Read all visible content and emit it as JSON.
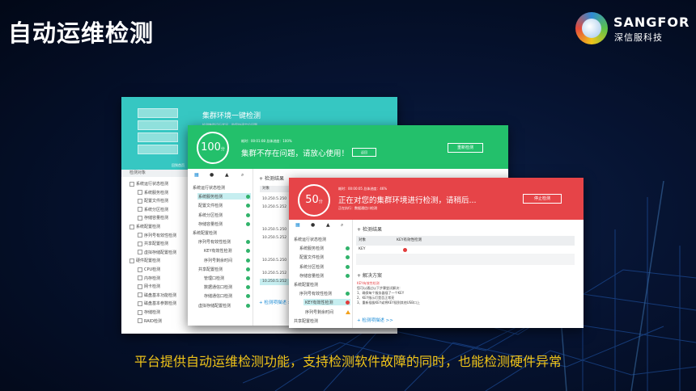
{
  "slide": {
    "title": "自动运维检测",
    "caption": "平台提供自动运维检测功能，支持检测软件故障的同时，也能检测硬件异常"
  },
  "logo": {
    "brand": "SANGFOR",
    "cn": "深信服科技"
  },
  "colors": {
    "teal": "#36c7c2",
    "green": "#23c06b",
    "red": "#e64448",
    "caption": "#f0c419"
  },
  "window1": {
    "title": "集群环境一键检测",
    "subtitle": "检测集群运行状况，助您快速定位问题",
    "back_link": "回到首页",
    "table_header": "检测对象",
    "tree": [
      {
        "label": "系统运行状态检测",
        "level": 0
      },
      {
        "label": "系统服务检测",
        "level": 1
      },
      {
        "label": "配置文件检测",
        "level": 1
      },
      {
        "label": "系统分区检测",
        "level": 1
      },
      {
        "label": "存储容量检测",
        "level": 1
      },
      {
        "label": "系统配置检测",
        "level": 0
      },
      {
        "label": "序列号有效性检测",
        "level": 1
      },
      {
        "label": "共享配置检测",
        "level": 1
      },
      {
        "label": "虚拟存储配置检测",
        "level": 1
      },
      {
        "label": "硬件配置检测",
        "level": 0
      },
      {
        "label": "CPU检测",
        "level": 1
      },
      {
        "label": "内存检测",
        "level": 1
      },
      {
        "label": "网卡检测",
        "level": 1
      },
      {
        "label": "磁盘基本功能检测",
        "level": 1
      },
      {
        "label": "磁盘基本参数检测",
        "level": 1
      },
      {
        "label": "存储检测",
        "level": 1
      },
      {
        "label": "RAID检测",
        "level": 1
      }
    ]
  },
  "window2": {
    "score": "100",
    "score_unit": "分",
    "meta": "耗时：00:01:08    总体进度：100%",
    "message": "集群不存在问题，请放心使用！",
    "small_button": "返回",
    "recheck_button": "重新检测",
    "result_title": "检测结果",
    "object_header": "对象",
    "tree": [
      {
        "label": "系统运行状态检测",
        "level": 0
      },
      {
        "label": "系统服务检测",
        "level": 1
      },
      {
        "label": "配置文件检测",
        "level": 1
      },
      {
        "label": "系统分区检测",
        "level": 1
      },
      {
        "label": "存储容量检测",
        "level": 1
      },
      {
        "label": "系统配置检测",
        "level": 0
      },
      {
        "label": "序列号有效性检测",
        "level": 1
      },
      {
        "label": "KEY有效性检测",
        "level": 2
      },
      {
        "label": "序列号剩余时间",
        "level": 2
      },
      {
        "label": "共享配置检测",
        "level": 1
      },
      {
        "label": "管理口检测",
        "level": 2
      },
      {
        "label": "数据通信口检测",
        "level": 2
      },
      {
        "label": "存储通信口检测",
        "level": 2
      },
      {
        "label": "虚拟存储配置检测",
        "level": 1
      }
    ],
    "objects": [
      "10.250.5.250",
      "10.250.5.252",
      "10.250.5.250",
      "10.250.5.252",
      "10.250.5.250",
      "10.250.5.252",
      "10.250.5.252"
    ],
    "more_link": "+ 检测项描述 >>"
  },
  "window3": {
    "score": "50",
    "score_unit": "分",
    "meta": "耗时：00:00:05    总体进度：46%",
    "message": "正在对您的集群环境进行检测，请稍后...",
    "subtext": "正在执行：数据通信口检测",
    "stop_button": "停止检测",
    "result_title": "检测结果",
    "table": {
      "col1": "对象",
      "col2": "KEY有效性检测",
      "row_obj": "KEY"
    },
    "tree": [
      {
        "label": "系统运行状态检测",
        "level": 0
      },
      {
        "label": "系统服务检测",
        "level": 1
      },
      {
        "label": "配置文件检测",
        "level": 1
      },
      {
        "label": "系统分区检测",
        "level": 1
      },
      {
        "label": "存储容量检测",
        "level": 1
      },
      {
        "label": "系统配置检测",
        "level": 0
      },
      {
        "label": "序列号有效性检测",
        "level": 1
      },
      {
        "label": "KEY有效性检测",
        "level": 2
      },
      {
        "label": "序列号剩余时间",
        "level": 2
      },
      {
        "label": "共享配置检测",
        "level": 0
      }
    ],
    "plan_title": "解决方案",
    "plan_lines": [
      "KEY有效性检测",
      "您可以通过以下步骤尝试解决：",
      "1、确保每个服务器插了一个KEY",
      "2、KEY指示灯是否正常亮",
      "3、重新插拔KEY或将KEY插到其他USB口上"
    ],
    "more_link": "+ 检测项描述 >>"
  }
}
